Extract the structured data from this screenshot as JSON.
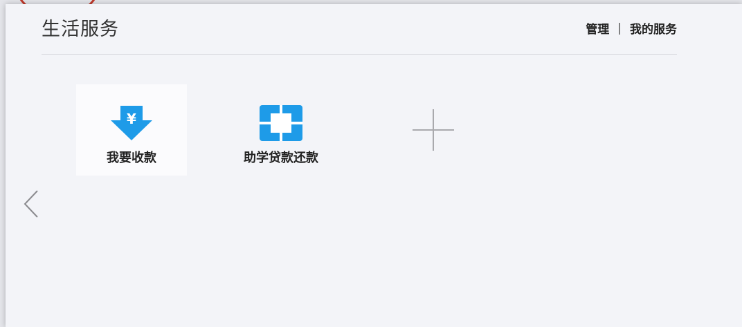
{
  "panel": {
    "title": "生活服务",
    "links": {
      "manage": "管理",
      "separator": "|",
      "my_services": "我的服务"
    }
  },
  "services": [
    {
      "label": "我要收款",
      "icon": "yen-download-icon",
      "color": "#1e9be8"
    },
    {
      "label": "助学贷款还款",
      "icon": "loan-repay-icon",
      "color": "#1e9be8"
    }
  ],
  "add_tile": {
    "icon": "plus-icon"
  },
  "nav": {
    "prev_icon": "chevron-left-icon"
  }
}
